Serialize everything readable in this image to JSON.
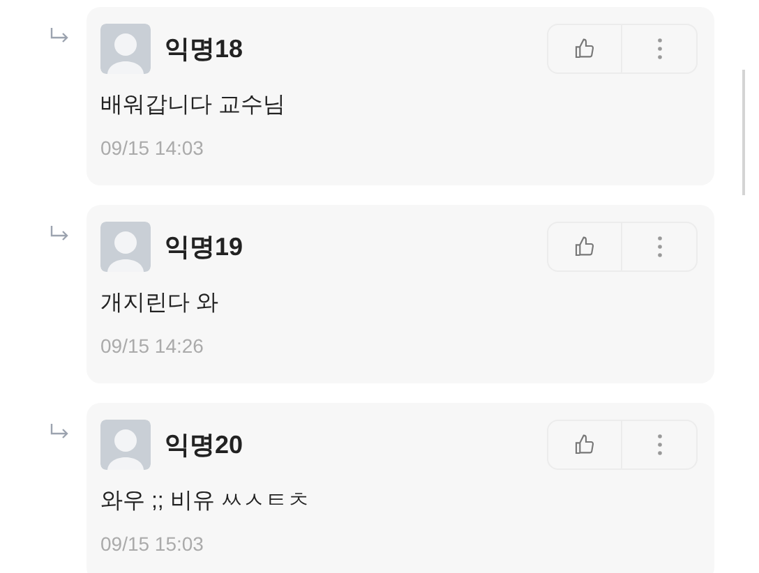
{
  "comments": [
    {
      "author": "익명18",
      "text": "배워갑니다 교수님",
      "time": "09/15 14:03"
    },
    {
      "author": "익명19",
      "text": "개지린다 와",
      "time": "09/15 14:26"
    },
    {
      "author": "익명20",
      "text": "와우 ;; 비유 ㅆㅅㅌㅊ",
      "time": "09/15 15:03"
    }
  ]
}
